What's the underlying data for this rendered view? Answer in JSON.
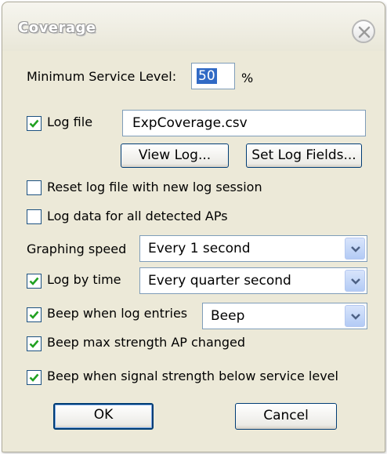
{
  "window": {
    "title": "Coverage"
  },
  "min_service": {
    "label": "Minimum Service Level:",
    "value": "50",
    "unit": "%"
  },
  "log_file": {
    "label": "Log file",
    "checked": true,
    "value": "ExpCoverage.csv"
  },
  "buttons": {
    "view_log": "View Log...",
    "set_log_fields": "Set Log Fields...",
    "ok": "OK",
    "cancel": "Cancel"
  },
  "options": {
    "reset_log": {
      "label": "Reset log file with new log session",
      "checked": false
    },
    "log_all_aps": {
      "label": "Log data for all detected APs",
      "checked": false
    }
  },
  "graphing_speed": {
    "label": "Graphing speed",
    "selected": "Every 1 second"
  },
  "log_by_time": {
    "label": "Log by time",
    "checked": true,
    "selected": "Every quarter second"
  },
  "beep_log_entries": {
    "label": "Beep when log entries",
    "checked": true,
    "selected": "Beep"
  },
  "beep_max_strength": {
    "label": "Beep max strength AP changed",
    "checked": true
  },
  "beep_signal_below": {
    "label": "Beep when signal strength below service level",
    "checked": true
  },
  "icons": {
    "close": "close-icon",
    "check": "checkmark-icon",
    "dropdown": "chevron-down-icon"
  },
  "colors": {
    "accent": "#316ac5",
    "dialog_bg": "#ece9d8",
    "check_green": "#21a121"
  }
}
